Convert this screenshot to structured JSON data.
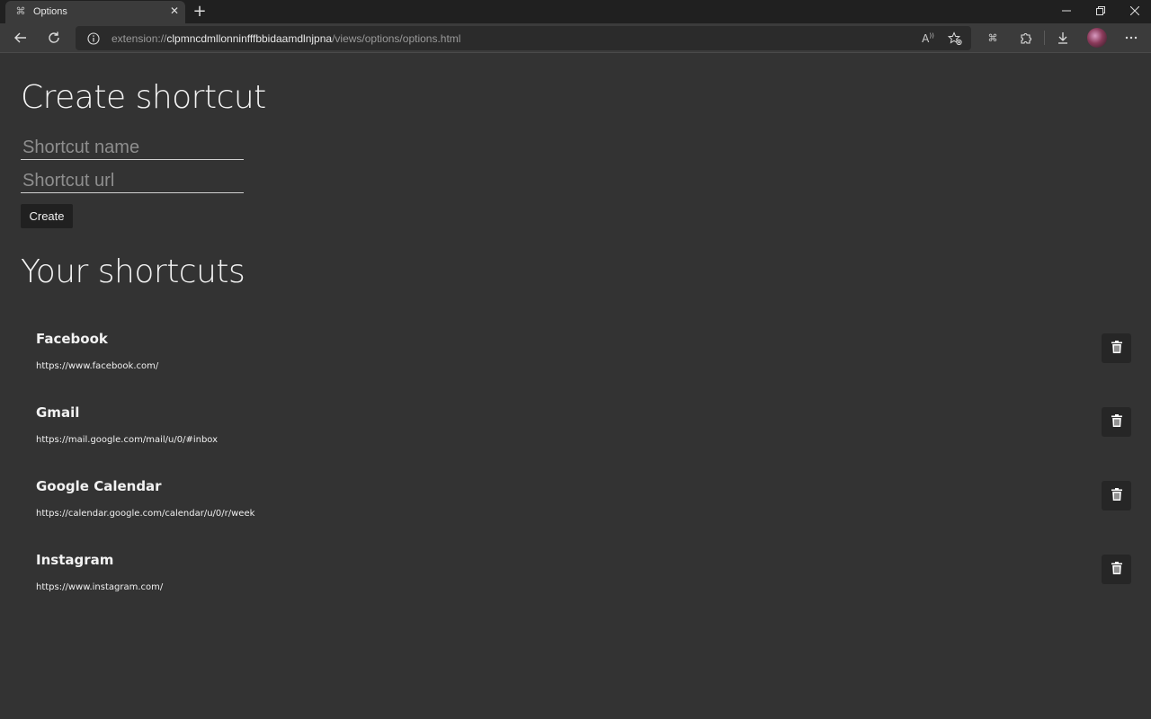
{
  "browser": {
    "tab_title": "Options",
    "url_scheme": "extension://",
    "url_host": "clpmncdmllonninfffbbidaamdlnjpna",
    "url_path": "/views/options/options.html",
    "icons": {
      "tab_favicon": "extension-icon",
      "tab_close": "close-icon",
      "new_tab": "plus-icon",
      "back": "back-arrow-icon",
      "refresh": "refresh-icon",
      "site_info": "info-icon",
      "read_aloud": "read-aloud-icon",
      "favorites": "star-add-icon",
      "extension": "extension-icon",
      "extensions": "puzzle-icon",
      "downloads": "download-icon",
      "profile": "avatar",
      "more": "more-icon"
    }
  },
  "create": {
    "heading": "Create shortcut",
    "name_placeholder": "Shortcut name",
    "url_placeholder": "Shortcut url",
    "button_label": "Create"
  },
  "list": {
    "heading": "Your shortcuts",
    "items": [
      {
        "name": "Facebook",
        "url": "https://www.facebook.com/"
      },
      {
        "name": "Gmail",
        "url": "https://mail.google.com/mail/u/0/#inbox"
      },
      {
        "name": "Google Calendar",
        "url": "https://calendar.google.com/calendar/u/0/r/week"
      },
      {
        "name": "Instagram",
        "url": "https://www.instagram.com/"
      }
    ]
  },
  "colors": {
    "page_bg": "#333333",
    "titlebar_bg": "#202020",
    "toolbar_bg": "#3b3b3b",
    "button_bg": "#202020"
  }
}
